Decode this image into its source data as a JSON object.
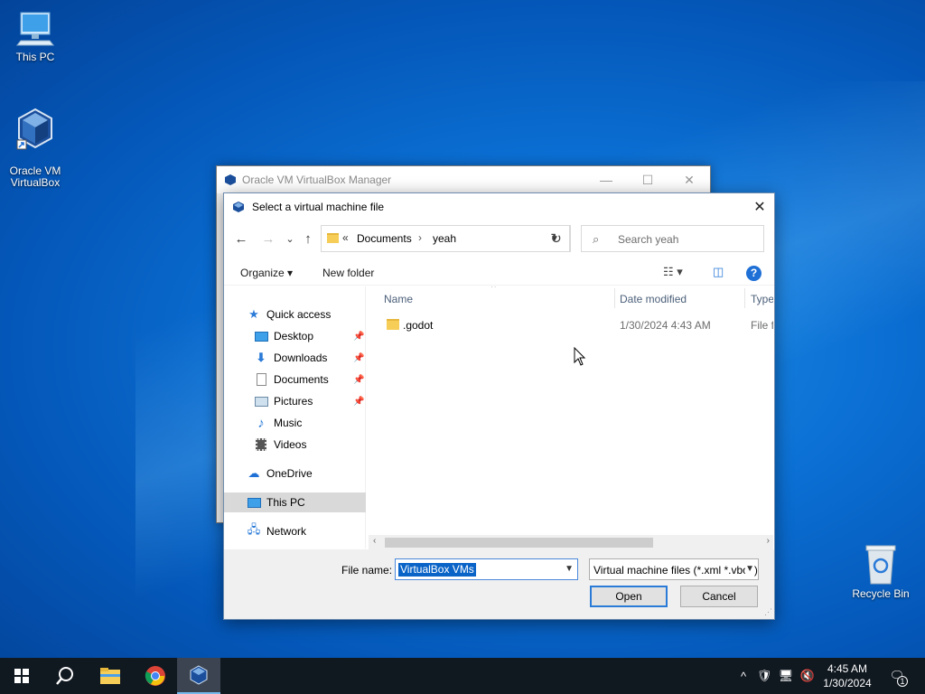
{
  "desktop": {
    "icons": [
      {
        "label": "This PC"
      },
      {
        "label": "Oracle VM\nVirtualBox"
      },
      {
        "label": "Recycle Bin"
      }
    ]
  },
  "manager_window": {
    "title": "Oracle VM VirtualBox Manager",
    "minimize": "—",
    "maximize": "☐",
    "close": "✕"
  },
  "dialog": {
    "title": "Select a virtual machine file",
    "close": "✕",
    "nav": {
      "back": "←",
      "forward": "→",
      "recent": "⌄",
      "up": "↑",
      "refresh": "↻"
    },
    "address": {
      "overflow": "«",
      "crumbs": [
        "Documents",
        "yeah"
      ],
      "separator": "›"
    },
    "search": {
      "placeholder": "Search yeah"
    },
    "toolbar": {
      "organize": "Organize ▾",
      "new_folder": "New folder",
      "help": "?"
    },
    "navpane": {
      "quick_access": "Quick access",
      "items": [
        "Desktop",
        "Downloads",
        "Documents",
        "Pictures",
        "Music",
        "Videos"
      ],
      "onedrive": "OneDrive",
      "this_pc": "This PC",
      "network": "Network"
    },
    "columns": {
      "name": "Name",
      "date_modified": "Date modified",
      "type": "Type"
    },
    "files": [
      {
        "name": ".godot",
        "date_modified": "1/30/2024 4:43 AM",
        "type": "File folder"
      }
    ],
    "filename_label": "File name:",
    "filename_value": "VirtualBox VMs",
    "filetype_value": "Virtual machine files (*.xml *.vbox)",
    "open_label": "Open",
    "cancel_label": "Cancel"
  },
  "taskbar": {
    "time": "4:45 AM",
    "date": "1/30/2024",
    "notification_count": "1",
    "tray_chevron": "^"
  },
  "colors": {
    "accent": "#0078d7",
    "selection": "#0a64c8",
    "taskbar": "#101820"
  }
}
